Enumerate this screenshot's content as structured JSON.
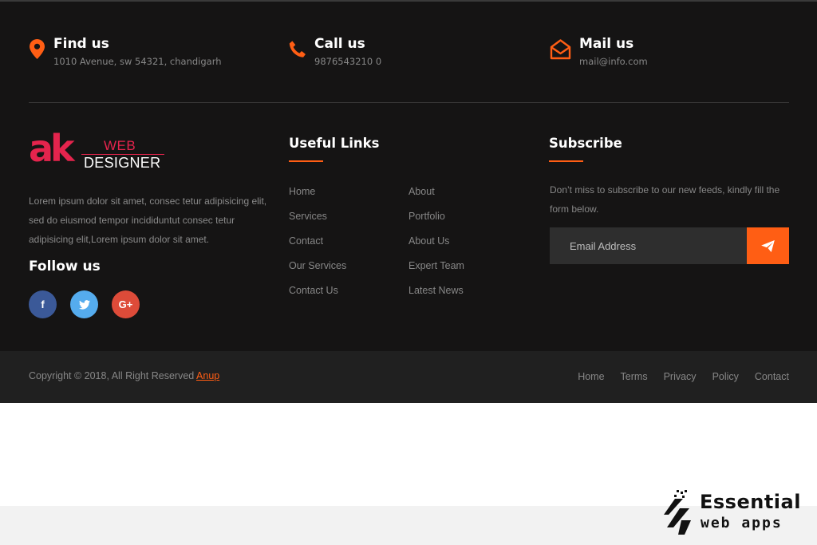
{
  "contacts": [
    {
      "title": "Find us",
      "text": "1010 Avenue, sw 54321, chandigarh",
      "icon": "map-marker-icon"
    },
    {
      "title": "Call us",
      "text": "9876543210 0",
      "icon": "phone-icon"
    },
    {
      "title": "Mail us",
      "text": "mail@info.com",
      "icon": "envelope-open-icon"
    }
  ],
  "logo": {
    "mark": "ak",
    "line1": "WEB",
    "line2": "DESIGNER"
  },
  "about": "Lorem ipsum dolor sit amet, consec tetur adipisicing elit, sed do eiusmod tempor incididuntut consec tetur adipisicing elit,Lorem ipsum dolor sit amet.",
  "follow_title": "Follow us",
  "social": [
    {
      "label": "f",
      "icon": "facebook-icon"
    },
    {
      "label": "🐦",
      "icon": "twitter-icon"
    },
    {
      "label": "G+",
      "icon": "google-plus-icon"
    }
  ],
  "useful_links": {
    "title": "Useful Links",
    "col1": [
      "Home",
      "Services",
      "Contact",
      "Our Services",
      "Contact Us"
    ],
    "col2": [
      "About",
      "Portfolio",
      "About Us",
      "Expert Team",
      "Latest News"
    ]
  },
  "subscribe": {
    "title": "Subscribe",
    "text": "Don’t miss to subscribe to our new feeds, kindly fill the form below.",
    "placeholder": "Email Address",
    "button_icon": "send-icon"
  },
  "copyright": {
    "text": "Copyright © 2018, All Right Reserved ",
    "brand": "Anup"
  },
  "footer_menu": [
    "Home",
    "Terms",
    "Privacy",
    "Policy",
    "Contact"
  ],
  "watermark": {
    "line1": "Essential",
    "line2": "web apps"
  },
  "colors": {
    "accent": "#ff5e14",
    "logo_red": "#e4244d",
    "bg": "#151414",
    "bar": "#202020"
  }
}
